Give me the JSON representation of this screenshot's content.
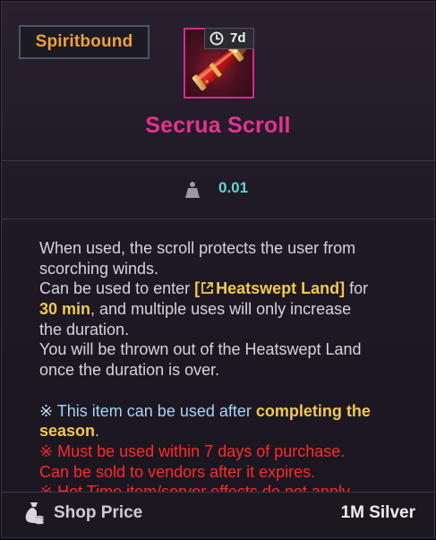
{
  "tooltip": {
    "bind_label": "Spiritbound",
    "duration": "7d",
    "item_name": "Secrua Scroll",
    "weight": "0.01",
    "icon_name": "scroll-icon",
    "colors": {
      "bind": "#f0a13a",
      "item_name": "#e8318f",
      "weight": "#5fd6cf",
      "highlight": "#f2c94c",
      "note": "#a9d4f2",
      "warning": "#ff2a2a"
    }
  },
  "description": {
    "l1": "When used, the scroll protects the user from",
    "l2": "scorching winds.",
    "l3a": "Can be used to enter ",
    "l3b_open": "[",
    "l3b_name": "Heatswept Land]",
    "l3c": " for",
    "l4a": "30 min",
    "l4b": ", and multiple uses will only increase",
    "l5": "the duration.",
    "l6": "You will be thrown out of the Heatswept Land",
    "l7": "once the duration is over.",
    "n1_mark": "※",
    "n1a": " This item can be used after ",
    "n1b": "completing the",
    "n1c": "season",
    "n1d": ".",
    "n2_mark": "※",
    "n2a": " Must be used within 7 days of purchase.",
    "n2b": "Can be sold to vendors after it expires.",
    "n3_mark": "※",
    "n3a": " Hot Time item/server effects do not apply."
  },
  "footer": {
    "label": "Shop Price",
    "value": "1M Silver"
  }
}
